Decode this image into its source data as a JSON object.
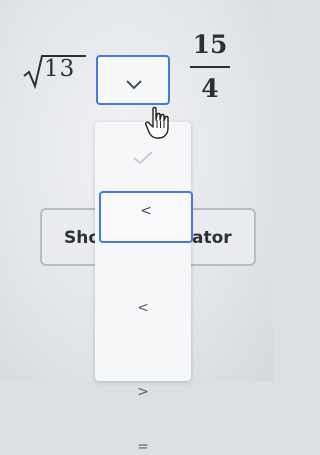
{
  "expression": {
    "radical": {
      "radicand": "13"
    },
    "fraction": {
      "numerator": "15",
      "denominator": "4"
    },
    "comparison_dropdown": {
      "selected": ""
    }
  },
  "calculator_button": {
    "label_left": "Sho",
    "label_right": "ator"
  },
  "dropdown": {
    "options": [
      {
        "symbol": "",
        "icon": "check-icon"
      },
      {
        "symbol": "<"
      },
      {
        "symbol": ">"
      },
      {
        "symbol": "="
      }
    ]
  },
  "colors": {
    "accent": "#4b76e6",
    "text": "#2d2f33",
    "muted": "#5b5f66"
  }
}
